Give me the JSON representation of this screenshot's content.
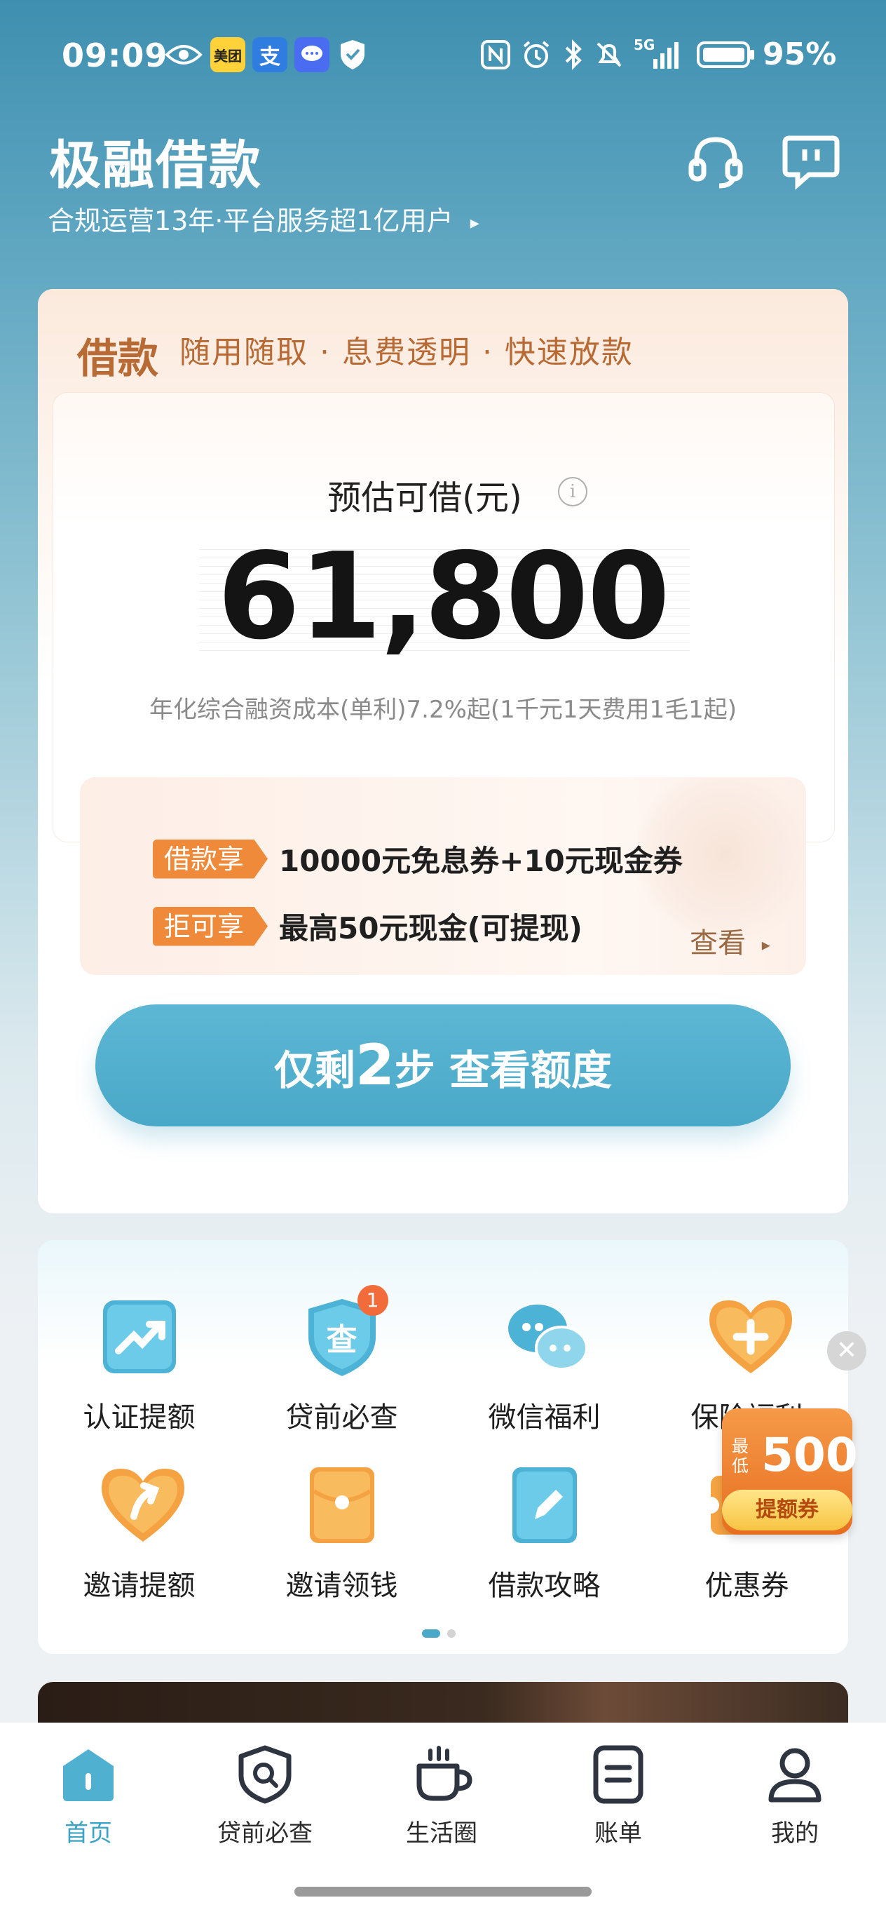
{
  "status_bar": {
    "time": "09:09",
    "battery_percent": "95%",
    "app_icons": [
      "eye-icon",
      "meituan-icon",
      "alipay-icon",
      "chat-bubble-icon",
      "shield-icon"
    ],
    "app_icon_text": {
      "meituan": "美团",
      "alipay": "支"
    },
    "system_icons": [
      "nfc-icon",
      "alarm-icon",
      "bluetooth-icon",
      "mute-icon",
      "signal-5g-icon",
      "battery-icon"
    ],
    "network": "5G"
  },
  "header": {
    "title": "极融借款",
    "subtitle": "合规运营13年·平台服务超1亿用户",
    "subtitle_arrow": "▸",
    "icons": [
      "headset-icon",
      "message-icon"
    ]
  },
  "loan_card": {
    "tag": "借款",
    "slogan": "随用随取 · 息费透明 · 快速放款",
    "estimate_label": "预估可借(元)",
    "info_icon_glyph": "i",
    "amount": "61,800",
    "rate_text": "年化综合融资成本(单利)7.2%起(1千元1天费用1毛1起)",
    "promos": [
      {
        "chip": "借款享",
        "text": "10000元免息券+10元现金券"
      },
      {
        "chip": "拒可享",
        "text": "最高50元现金(可提现)"
      }
    ],
    "view_label": "查看",
    "view_arrow": "▸",
    "cta": {
      "prefix": "仅剩",
      "number": "2",
      "suffix": "步 查看额度"
    }
  },
  "features": {
    "items": [
      {
        "label": "认证提额",
        "icon": "trend-up-icon"
      },
      {
        "label": "贷前必查",
        "icon": "check-shield-icon",
        "icon_text": "查",
        "badge": "1"
      },
      {
        "label": "微信福利",
        "icon": "wechat-icon"
      },
      {
        "label": "保险福利",
        "icon": "heart-plus-icon"
      },
      {
        "label": "邀请提额",
        "icon": "heart-arrow-icon"
      },
      {
        "label": "邀请领钱",
        "icon": "red-envelope-icon"
      },
      {
        "label": "借款攻略",
        "icon": "pencil-note-icon"
      },
      {
        "label": "优惠券",
        "icon": "coupon-icon"
      }
    ],
    "page_count": 2,
    "current_page": 1
  },
  "floating_promo": {
    "close_glyph": "✕",
    "min_label": "最低",
    "value": "500",
    "tag": "提额券"
  },
  "tab_bar": {
    "tabs": [
      {
        "label": "首页",
        "icon": "home-icon",
        "active": true
      },
      {
        "label": "贷前必查",
        "icon": "search-shield-icon",
        "active": false
      },
      {
        "label": "生活圈",
        "icon": "coffee-cup-icon",
        "active": false
      },
      {
        "label": "账单",
        "icon": "bill-icon",
        "active": false
      },
      {
        "label": "我的",
        "icon": "user-icon",
        "active": false
      }
    ]
  },
  "colors": {
    "brand_blue": "#4aa8c8",
    "orange": "#f08a3b",
    "loan_tag_brown": "#b86a34",
    "active_tab": "#3aa3c6"
  }
}
